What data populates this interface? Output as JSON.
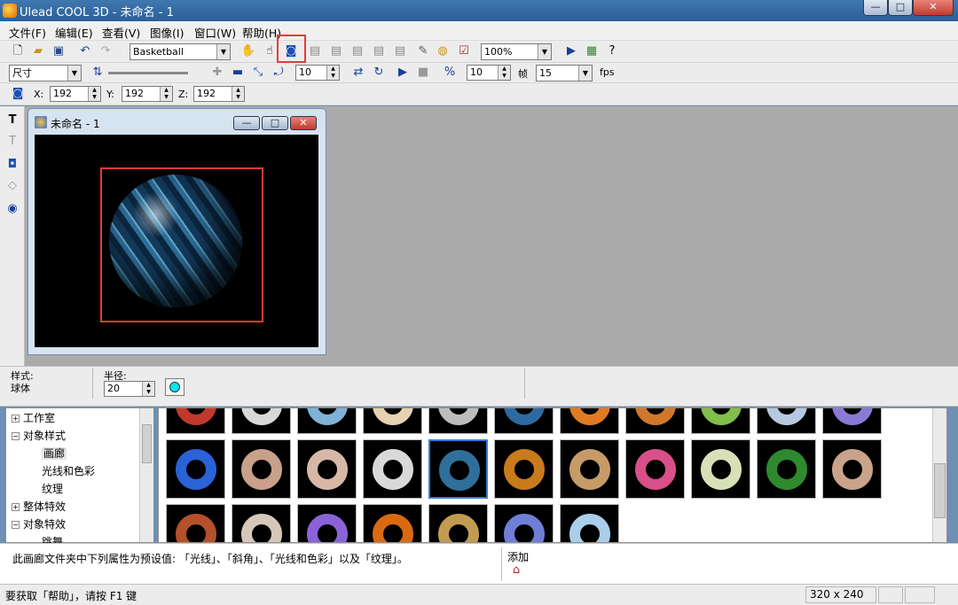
{
  "window": {
    "title": "Ulead COOL 3D - 未命名 - 1",
    "minimize": "—",
    "maximize": "□",
    "close": "✕"
  },
  "menu": [
    "文件(F)",
    "编辑(E)",
    "查看(V)",
    "图像(I)",
    "窗口(W)",
    "帮助(H)"
  ],
  "toolbar1": {
    "object_combo": "Basketball",
    "zoom_combo": "100%"
  },
  "toolbar2": {
    "mode_combo": "尺寸",
    "speed_value": "10",
    "frames_value": "10",
    "frames_label": "帧",
    "fps_value": "15",
    "fps_label": "fps"
  },
  "toolbar3": {
    "x_label": "X:",
    "x_value": "192",
    "y_label": "Y:",
    "y_value": "192",
    "z_label": "Z:",
    "z_value": "192"
  },
  "document": {
    "title": "未命名 - 1"
  },
  "properties": {
    "style_label": "样式:",
    "style_value": "球体",
    "radius_label": "半径:",
    "radius_value": "20",
    "color": "#00e5ee"
  },
  "tree": [
    {
      "label": "工作室",
      "expander": "+",
      "indent": 0
    },
    {
      "label": "对象样式",
      "expander": "−",
      "indent": 0
    },
    {
      "label": "画廊",
      "expander": "",
      "indent": 1
    },
    {
      "label": "光线和色彩",
      "expander": "",
      "indent": 1
    },
    {
      "label": "纹理",
      "expander": "",
      "indent": 1
    },
    {
      "label": "整体特效",
      "expander": "+",
      "indent": 0
    },
    {
      "label": "对象特效",
      "expander": "−",
      "indent": 0
    },
    {
      "label": "跳舞",
      "expander": "",
      "indent": 1
    }
  ],
  "gallery_colors": [
    "#c0392b",
    "#d8d8d8",
    "#7fb2d6",
    "#e6d2b0",
    "#bdbdbd",
    "#2c6aa1",
    "#e07b22",
    "#d2772a",
    "#7fbf4a",
    "#b7c9e0",
    "#8a7ad6",
    "#2a62d8",
    "#c9a08a",
    "#d7b8a6",
    "#d9d9d9",
    "#2f6f9a",
    "#c97a1a",
    "#c79b68",
    "#d94f8a",
    "#d8e0b8",
    "#2e8a2e",
    "#c9a28a",
    "#b4502a",
    "#d6c8b8",
    "#8b62d8",
    "#d96a12",
    "#c29a52",
    "#6f7fd6",
    "#a9cfea"
  ],
  "info": {
    "text": "此画廊文件夹中下列属性为预设值: 「光线」、「斜角」、「光线和色彩」以及「纹理」。",
    "add_label": "添加"
  },
  "status": {
    "help_text": "要获取「帮助」，请按 F1 键",
    "size": "320 x 240"
  }
}
